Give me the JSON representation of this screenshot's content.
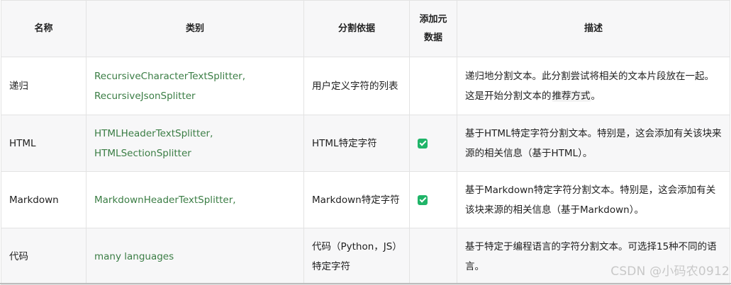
{
  "headers": {
    "name": "名称",
    "category": "类别",
    "split_basis": "分割依据",
    "add_metadata_line1": "添加元",
    "add_metadata_line2": "数据",
    "description": "描述"
  },
  "rows": [
    {
      "name": "递归",
      "category_links": [
        "RecursiveCharacterTextSplitter",
        "RecursiveJsonSplitter"
      ],
      "split_basis": "用户定义字符的列表",
      "add_metadata": false,
      "description_before": "递归地分割文本。此分割尝试将相关的文本片段放在一起。这是开始分割文本的",
      "description_code": "推荐方式",
      "description_after": "。"
    },
    {
      "name": "HTML",
      "category_links": [
        "HTMLHeaderTextSplitter",
        "HTMLSectionSplitter"
      ],
      "split_basis": "HTML特定字符",
      "add_metadata": true,
      "description": "基于HTML特定字符分割文本。特别是，这会添加有关该块来源的相关信息（基于HTML）。"
    },
    {
      "name": "Markdown",
      "category_links": [
        "MarkdownHeaderTextSplitter"
      ],
      "split_basis": "Markdown特定字符",
      "add_metadata": true,
      "description": "基于Markdown特定字符分割文本。特别是，这会添加有关该块来源的相关信息（基于Markdown）。"
    },
    {
      "name": "代码",
      "category_links": [
        "many languages"
      ],
      "split_basis": "代码（Python，JS）特定字符",
      "add_metadata": false,
      "description": "基于特定于编程语言的字符分割文本。可选择15种不同的语言。"
    }
  ],
  "link_separator": ",",
  "checkbox_icon": "checkbox-checked-icon",
  "colors": {
    "link": "#3a7d44",
    "check": "#1fb468",
    "header_bg": "#f7f7f8",
    "border": "#e3e3e3"
  },
  "watermark": "CSDN @小码农0912"
}
